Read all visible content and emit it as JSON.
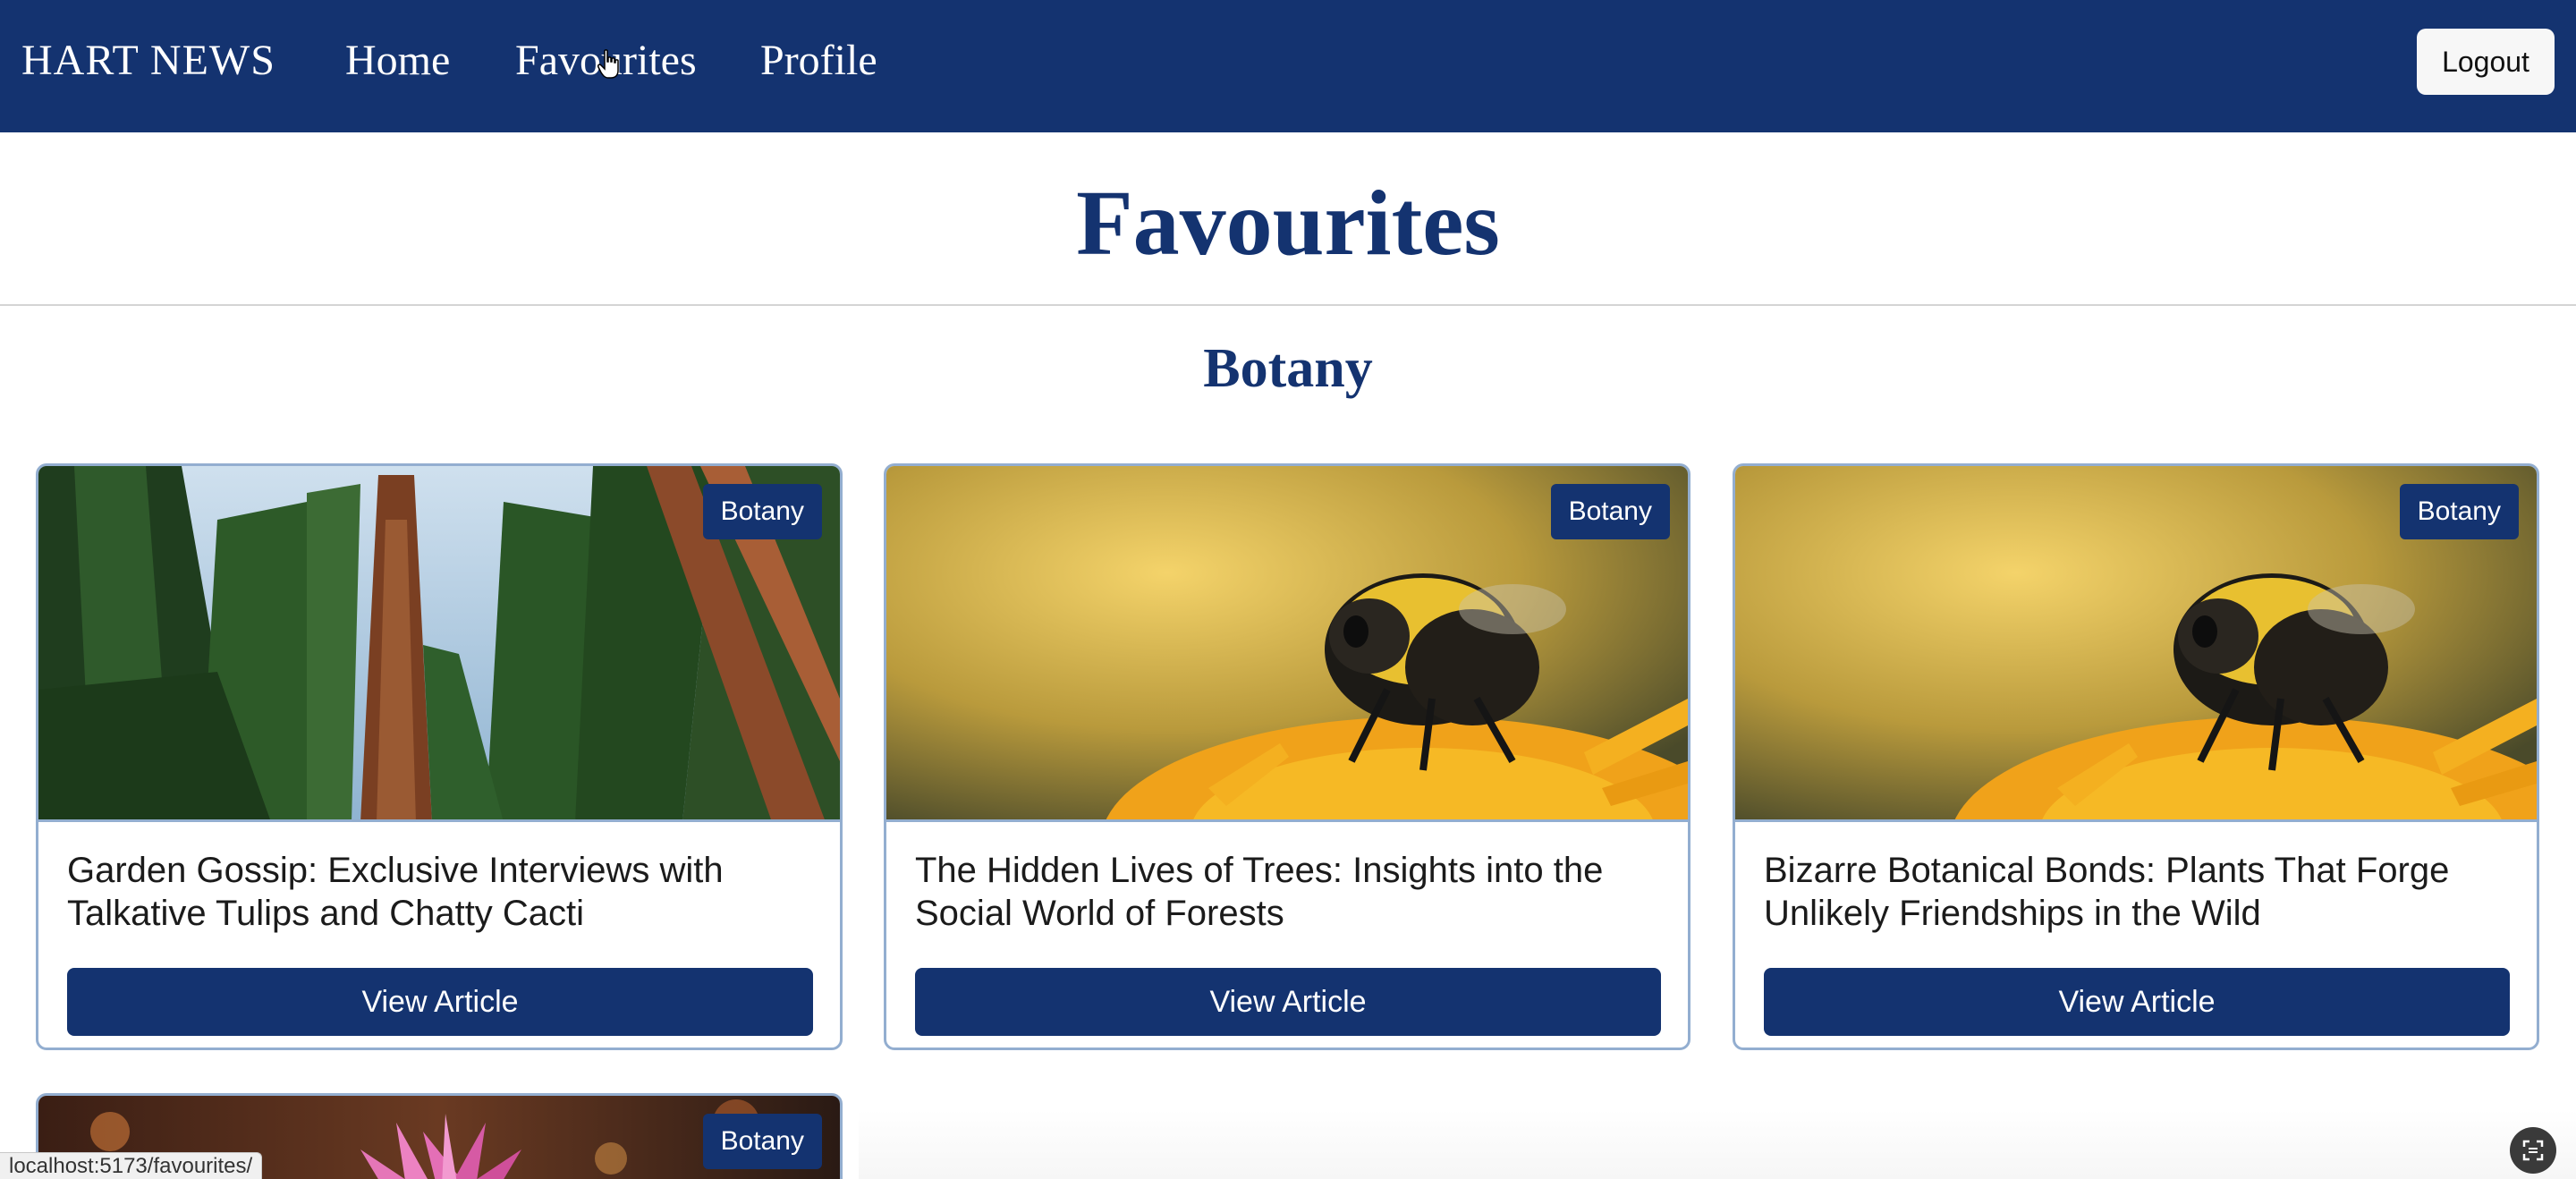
{
  "nav": {
    "brand": "HART NEWS",
    "links": [
      "Home",
      "Favourites",
      "Profile"
    ],
    "logout_label": "Logout"
  },
  "page": {
    "title": "Favourites",
    "section_title": "Botany"
  },
  "cards": [
    {
      "badge": "Botany",
      "title": "Garden Gossip: Exclusive Interviews with Talkative Tulips and Chatty Cacti",
      "button": "View Article",
      "image": "sequoia-forest"
    },
    {
      "badge": "Botany",
      "title": "The Hidden Lives of Trees: Insights into the Social World of Forests",
      "button": "View Article",
      "image": "bumblebee-flower"
    },
    {
      "badge": "Botany",
      "title": "Bizarre Botanical Bonds: Plants That Forge Unlikely Friendships in the Wild",
      "button": "View Article",
      "image": "bumblebee-flower"
    },
    {
      "badge": "Botany",
      "image": "pink-lotus"
    }
  ],
  "status_bar": {
    "url": "localhost:5173/favourites/"
  },
  "colors": {
    "brand": "#143370",
    "card_border": "#93aed0"
  },
  "icons": {
    "cursor": "hand-pointer-icon",
    "corner": "screen-capture-icon"
  }
}
